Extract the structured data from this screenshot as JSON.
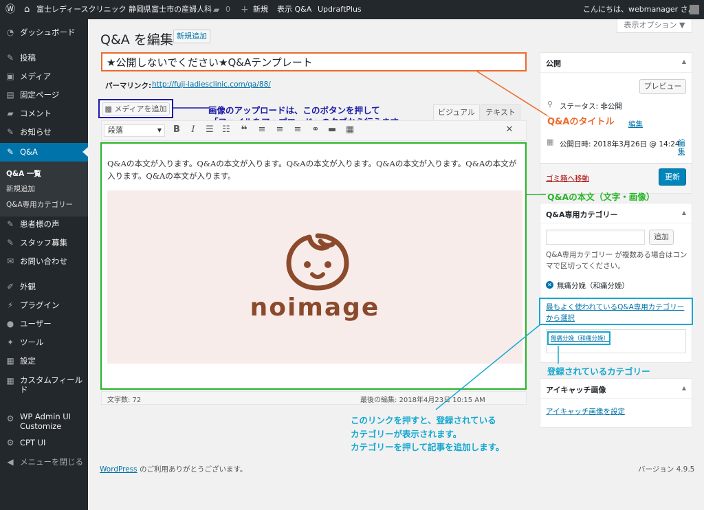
{
  "adminbar": {
    "site_name": "富士レディースクリニック 静岡県富士市の産婦人科",
    "comments_count": "0",
    "new_label": "新規",
    "view_label": "表示 Q&A",
    "updraft_label": "UpdraftPlus",
    "greeting": "こんにちは、webmanager さん"
  },
  "sidebar": {
    "items": [
      {
        "label": "ダッシュボード"
      },
      {
        "label": "投稿"
      },
      {
        "label": "メディア"
      },
      {
        "label": "固定ページ"
      },
      {
        "label": "コメント"
      },
      {
        "label": "お知らせ"
      },
      {
        "label": "Q&A"
      },
      {
        "label": "患者様の声"
      },
      {
        "label": "スタッフ募集"
      },
      {
        "label": "お問い合わせ"
      },
      {
        "label": "外観"
      },
      {
        "label": "プラグイン"
      },
      {
        "label": "ユーザー"
      },
      {
        "label": "ツール"
      },
      {
        "label": "設定"
      },
      {
        "label": "カスタムフィールド"
      },
      {
        "label": "WP Admin UI Customize"
      },
      {
        "label": "CPT UI"
      },
      {
        "label": "メニューを閉じる"
      }
    ],
    "submenu": [
      "Q&A 一覧",
      "新規追加",
      "Q&A専用カテゴリー"
    ]
  },
  "screen_options_label": "表示オプション ▼",
  "page": {
    "title": "Q&A を編集",
    "add_new": "新規追加"
  },
  "editor": {
    "post_title": "★公開しないでください★Q&Aテンプレート",
    "permalink_label": "パーマリンク:",
    "permalink_url": "http://fuji-ladiesclinic.com/qa/88/",
    "add_media": "メディアを追加",
    "tab_visual": "ビジュアル",
    "tab_text": "テキスト",
    "format_select": "段落",
    "body_text": "Q&Aの本文が入ります。Q&Aの本文が入ります。Q&Aの本文が入ります。Q&Aの本文が入ります。Q&Aの本文が入ります。Q&Aの本文が入ります。",
    "image_text": "noimage",
    "word_count": "文字数: 72",
    "last_edited": "最後の編集: 2018年4月23日 10:15 AM"
  },
  "publish": {
    "heading": "公開",
    "preview": "プレビュー",
    "status": "ステータス: 非公開",
    "status_edit": "編集",
    "date": "公開日時: 2018年3月26日 @ 14:24",
    "date_edit": "編集",
    "trash": "ゴミ箱へ移動",
    "update": "更新"
  },
  "category_box": {
    "heading": "Q&A専用カテゴリー",
    "add_button": "追加",
    "help": "Q&A専用カテゴリー が複数ある場合はコンマで区切ってください。",
    "tag": "無痛分娩（和痛分娩）",
    "choose_link": "最もよく使われているQ&A専用カテゴリーから選択",
    "popular_tag": "無痛分娩（和痛分娩）"
  },
  "eyecatch": {
    "heading": "アイキャッチ画像",
    "set_link": "アイキャッチ画像を設定"
  },
  "annotations": {
    "media_note_1": "画像のアップロードは、このボタンを押して",
    "media_note_2": "「ファイルをアップロード」のタブから行えます。",
    "title_note": "Q&Aのタイトル",
    "body_note": "Q&Aの本文（文字・画像）",
    "registered_note": "登録されているカテゴリー",
    "link_note_1": "このリンクを押すと、登録されている",
    "link_note_2": "カテゴリーが表示されます。",
    "link_note_3": "カテゴリーを押して記事を追加します。"
  },
  "footer": {
    "thanks_link": "WordPress",
    "thanks_rest": " のご利用ありがとうございます。",
    "version": "バージョン 4.9.5"
  },
  "colors": {
    "accent": "#0085ba",
    "annotation_orange": "#ee6a2c",
    "annotation_green": "#26b526",
    "annotation_blue": "#1a1aa8",
    "annotation_cyan": "#14a8cf",
    "image_bg": "#f7ecea",
    "image_brown": "#8b4a2b"
  }
}
